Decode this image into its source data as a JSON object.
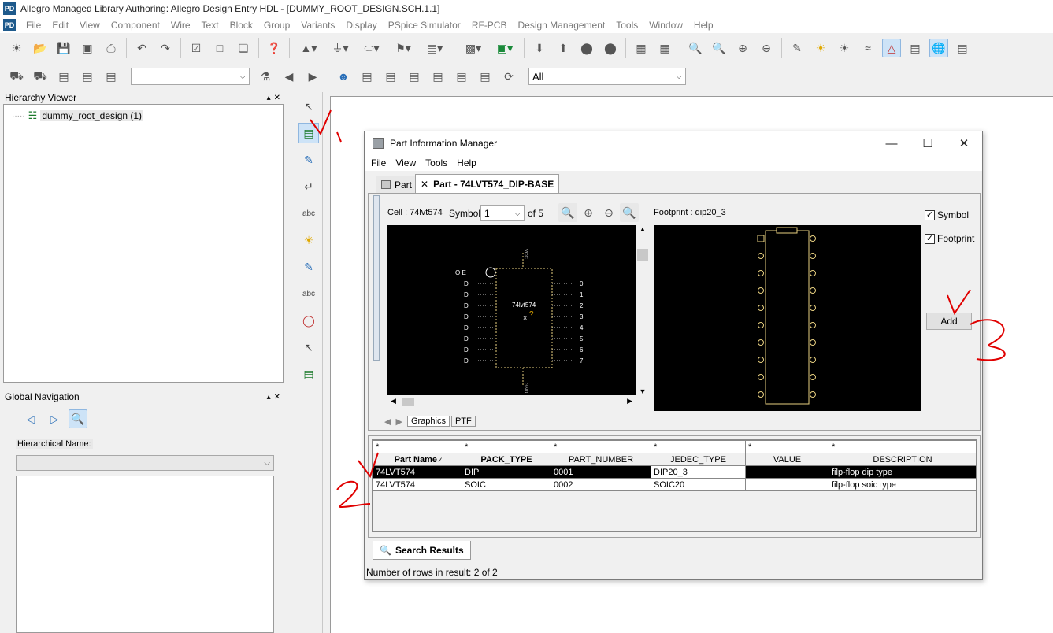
{
  "window": {
    "title": "Allegro Managed Library Authoring: Allegro Design Entry HDL - [DUMMY_ROOT_DESIGN.SCH.1.1]"
  },
  "menubar": [
    "File",
    "Edit",
    "View",
    "Component",
    "Wire",
    "Text",
    "Block",
    "Group",
    "Variants",
    "Display",
    "PSpice Simulator",
    "RF-PCB",
    "Design Management",
    "Tools",
    "Window",
    "Help"
  ],
  "toolbar2": {
    "combo1_value": "",
    "combo2_value": "All"
  },
  "hierarchy": {
    "header": "Hierarchy Viewer",
    "root": "dummy_root_design (1)"
  },
  "global_nav": {
    "header": "Global Navigation",
    "hier_name_label": "Hierarchical Name:"
  },
  "pim": {
    "title": "Part Information Manager",
    "menu": [
      "File",
      "View",
      "Tools",
      "Help"
    ],
    "tabs": {
      "part": "Part",
      "part_detail": "Part - 74LVT574_DIP-BASE"
    },
    "cell_label": "Cell : 74lvt574",
    "symbol_label": "Symbol",
    "symbol_value": "1",
    "of_label": "of 5",
    "footprint_label": "Footprint : dip20_3",
    "symbol_check": "Symbol",
    "footprint_check": "Footprint",
    "add_button": "Add",
    "sub_tabs": [
      "Graphics",
      "PTF"
    ],
    "symbol": {
      "name": "74lvt574",
      "vcc": "VCC",
      "gnd": "GND",
      "oe_label": "O E",
      "d_pins": [
        "D",
        "D",
        "D",
        "D",
        "D",
        "D",
        "D",
        "D"
      ],
      "q_pins": [
        "0",
        "1",
        "2",
        "3",
        "4",
        "5",
        "6",
        "7"
      ]
    },
    "filter_row": [
      "*",
      "*",
      "*",
      "*",
      "*",
      "*"
    ],
    "columns": [
      "Part Name",
      "PACK_TYPE",
      "PART_NUMBER",
      "JEDEC_TYPE",
      "VALUE",
      "DESCRIPTION"
    ],
    "rows": [
      {
        "part_name": "74LVT574",
        "pack_type": "DIP",
        "part_number": "0001",
        "jedec_type": "DIP20_3",
        "value": "",
        "description": "filp-flop dip type"
      },
      {
        "part_name": "74LVT574",
        "pack_type": "SOIC",
        "part_number": "0002",
        "jedec_type": "SOIC20",
        "value": "",
        "description": "filp-flop soic type"
      }
    ],
    "search_tab": "Search Results",
    "status": "Number of rows in result: 2 of 2"
  }
}
